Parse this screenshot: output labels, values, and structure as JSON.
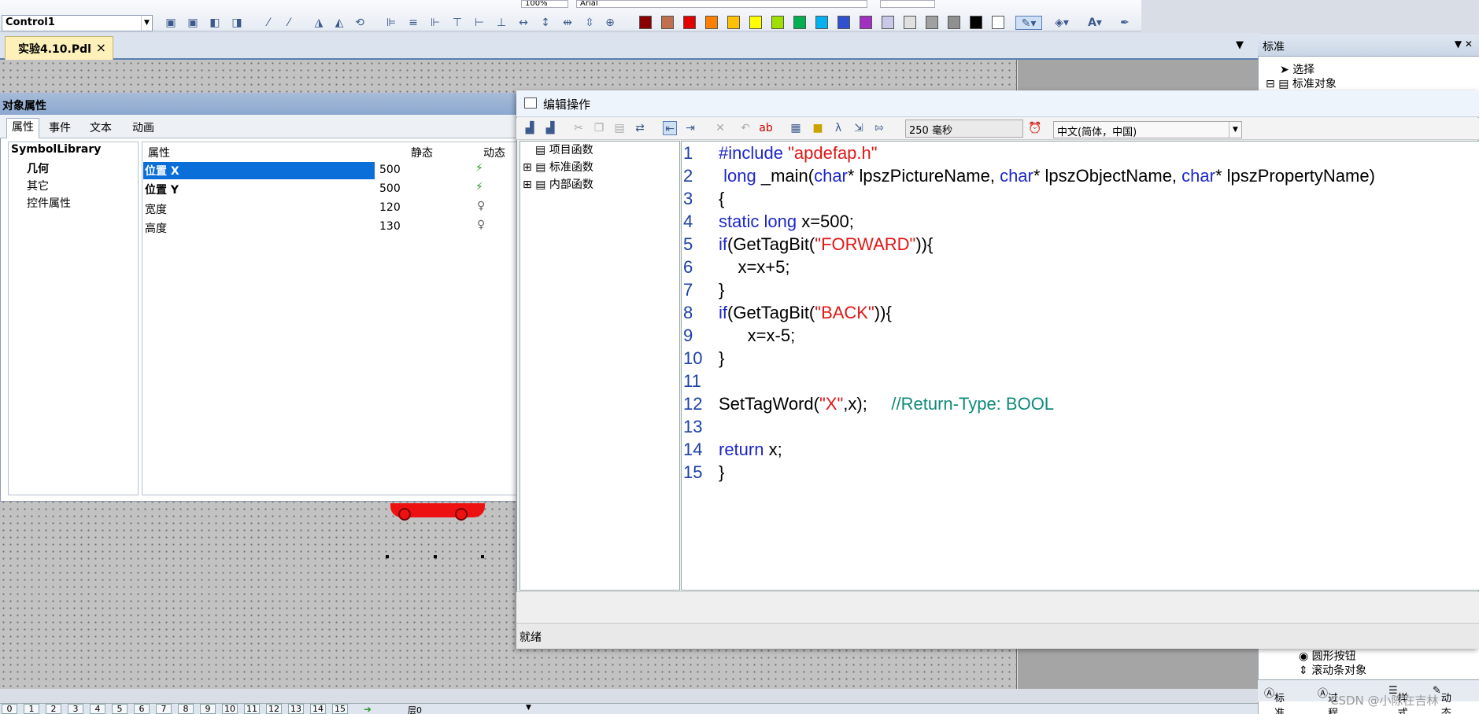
{
  "toolbar": {
    "object_selector": "Control1",
    "zoom_value": "100%",
    "font_value": "Arial",
    "swatches": [
      "#8b0000",
      "#c0704e",
      "#e00000",
      "#ff8000",
      "#ffc000",
      "#ffff00",
      "#a0e000",
      "#00b050",
      "#00b0f0",
      "#3050d0",
      "#a030c0",
      "#c8c8e8",
      "#e0e0e0",
      "#a0a0a0",
      "#909090",
      "#000000",
      "#ffffff"
    ]
  },
  "doc_tab": {
    "label": "实验4.10.Pdl",
    "close": "×"
  },
  "object_properties": {
    "title": "对象属性",
    "tabs": [
      "属性",
      "事件",
      "文本",
      "动画"
    ],
    "tree": [
      "SymbolLibrary",
      "几何",
      "其它",
      "控件属性"
    ],
    "columns": [
      "属性",
      "静态",
      "动态"
    ],
    "rows": [
      {
        "name": "位置 X",
        "value": "500",
        "dyn": "lightning"
      },
      {
        "name": "位置 Y",
        "value": "500",
        "dyn": "lightning"
      },
      {
        "name": "宽度",
        "value": "120",
        "dyn": "bulb"
      },
      {
        "name": "高度",
        "value": "130",
        "dyn": "bulb"
      }
    ]
  },
  "editor": {
    "title": "编辑操作",
    "cycle": "250 毫秒",
    "language": "中文(简体，中国)",
    "function_tree": [
      "项目函数",
      "标准函数",
      "内部函数"
    ],
    "line_numbers": [
      "1",
      "2",
      "3",
      "4",
      "5",
      "6",
      "7",
      "8",
      "9",
      "10",
      "11",
      "12",
      "13",
      "14",
      "15"
    ],
    "code": {
      "l1a": "#include ",
      "l1b": "\"apdefap.h\"",
      "l2a": " long",
      "l2b": " _main(",
      "l2c": "char",
      "l2d": "* lpszPictureName, ",
      "l2e": "char",
      "l2f": "* lpszObjectName, ",
      "l2g": "char",
      "l2h": "* lpszPropertyName)",
      "l3": "{",
      "l4a": "static",
      "l4b": " ",
      "l4c": "long",
      "l4d": " x=500;",
      "l5a": "if",
      "l5b": "(GetTagBit(",
      "l5c": "\"FORWARD\"",
      "l5d": ")){",
      "l6": "    x=x+5;",
      "l7": "}",
      "l8a": "if",
      "l8b": "(GetTagBit(",
      "l8c": "\"BACK\"",
      "l8d": ")){",
      "l9": "      x=x-5;",
      "l10": "}",
      "l12a": "SetTagWord(",
      "l12b": "\"X\"",
      "l12c": ",x);     ",
      "l12d": "//Return-Type: BOOL",
      "l14a": "return",
      "l14b": " x;",
      "l15": "}"
    },
    "status": "就绪"
  },
  "standard_pane": {
    "title": "标准",
    "tree_top": [
      "选择",
      "标准对象"
    ],
    "tree_bottom": [
      "圆形按钮",
      "滚动条对象"
    ],
    "tabs": [
      "标准",
      "过程画面",
      "样式",
      "动态向"
    ]
  },
  "layers": {
    "numbers": [
      "0",
      "1",
      "2",
      "3",
      "4",
      "5",
      "6",
      "7",
      "8",
      "9",
      "10",
      "11",
      "12",
      "13",
      "14",
      "15"
    ],
    "current": "层0"
  },
  "watermark": "CSDN @小陈在吉林"
}
